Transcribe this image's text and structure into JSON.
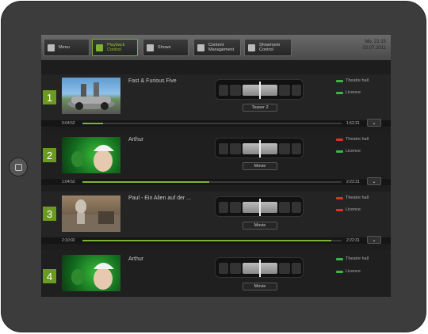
{
  "nav": {
    "menu": "Menu",
    "playback_line1": "Playback",
    "playback_line2": "Control",
    "shows": "Shows",
    "content_line1": "Content",
    "content_line2": "Management",
    "showroom_line1": "Showroom",
    "showroom_line2": "Control"
  },
  "datetime": {
    "line1": "Mo.   21:15",
    "line2": "03.07.2011"
  },
  "rows": [
    {
      "num": "1",
      "title": "Fast & Furious Five",
      "label": "Teaser 2",
      "theatre": "Theatre hall",
      "licence": "Licence",
      "theatre_color": "#39b54a",
      "licence_color": "#39b54a",
      "time_start": "0:04:52",
      "time_end": "1:52:31",
      "progress": 0.08
    },
    {
      "num": "2",
      "title": "Arthur",
      "label": "Movie",
      "theatre": "Theatre hall",
      "licence": "Licence",
      "theatre_color": "#d9342b",
      "licence_color": "#39b54a",
      "time_start": "1:04:52",
      "time_end": "2:22:31",
      "progress": 0.49
    },
    {
      "num": "3",
      "title": "Paul - Ein Alien auf der ...",
      "label": "Movie",
      "theatre": "Theatre hall",
      "licence": "Licence",
      "theatre_color": "#d9342b",
      "licence_color": "#d9342b",
      "time_start": "2:10:02",
      "time_end": "2:22:31",
      "progress": 0.96
    },
    {
      "num": "4",
      "title": "Arthur",
      "label": "Movie",
      "theatre": "Theatre hall",
      "licence": "Licence",
      "theatre_color": "#39b54a",
      "licence_color": "#39b54a"
    }
  ],
  "chevron": "⌄",
  "icons": {
    "menu": "home-icon",
    "playback": "playback-icon",
    "shows": "film-icon",
    "content": "content-icon",
    "showroom": "showroom-icon"
  }
}
